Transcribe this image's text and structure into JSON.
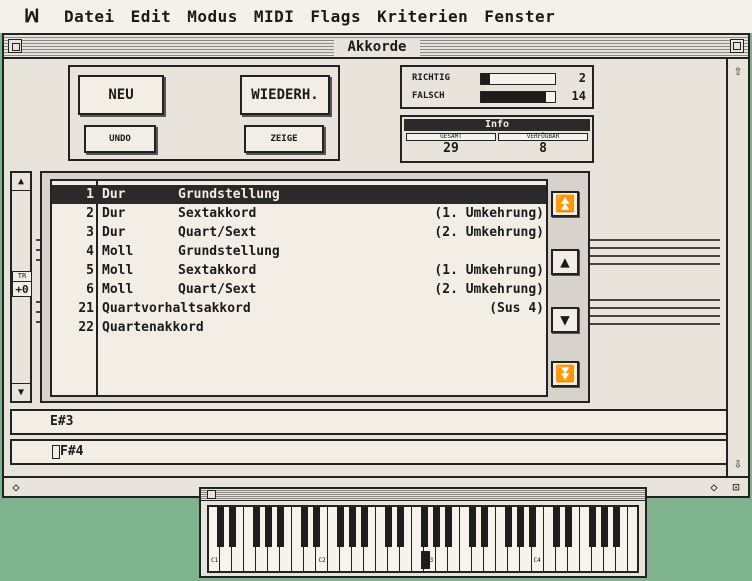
{
  "menubar": {
    "logo": "ꟽ",
    "items": [
      "Datei",
      "Edit",
      "Modus",
      "MIDI",
      "Flags",
      "Kriterien",
      "Fenster"
    ]
  },
  "window": {
    "title": "Akkorde"
  },
  "buttons": {
    "new": "NEU",
    "repeat": "WIEDERH.",
    "undo": "UNDO",
    "show": "ZEIGE"
  },
  "score": {
    "correct_label": "RICHTIG",
    "correct_value": "2",
    "correct_fraction": 0.12,
    "wrong_label": "FALSCH",
    "wrong_value": "14",
    "wrong_fraction": 0.88
  },
  "info": {
    "title": "Info",
    "total_label": "GESAMT",
    "total_value": "29",
    "available_label": "VERFÜGBAR",
    "available_value": "8"
  },
  "transpose": {
    "label": "TR",
    "value": "+0"
  },
  "chords": [
    {
      "num": "1",
      "type": "Dur",
      "position": "Grundstellung",
      "note": "",
      "selected": true
    },
    {
      "num": "2",
      "type": "Dur",
      "position": "Sextakkord",
      "note": "(1. Umkehrung)",
      "selected": false
    },
    {
      "num": "3",
      "type": "Dur",
      "position": "Quart/Sext",
      "note": "(2. Umkehrung)",
      "selected": false
    },
    {
      "num": "4",
      "type": "Moll",
      "position": "Grundstellung",
      "note": "",
      "selected": false
    },
    {
      "num": "5",
      "type": "Moll",
      "position": "Sextakkord",
      "note": "(1. Umkehrung)",
      "selected": false
    },
    {
      "num": "6",
      "type": "Moll",
      "position": "Quart/Sext",
      "note": "(2. Umkehrung)",
      "selected": false
    },
    {
      "num": "21",
      "type": "Quartvorhaltsakkord",
      "position": "",
      "note": "(Sus 4)",
      "selected": false
    },
    {
      "num": "22",
      "type": "Quartenakkord",
      "position": "",
      "note": "",
      "selected": false
    }
  ],
  "notes": {
    "field1": "E#3",
    "field2": "F#4"
  },
  "keyboard": {
    "octave_labels": [
      "C1",
      "C2",
      "C3",
      "C4"
    ],
    "pressed_key": "F#3"
  }
}
